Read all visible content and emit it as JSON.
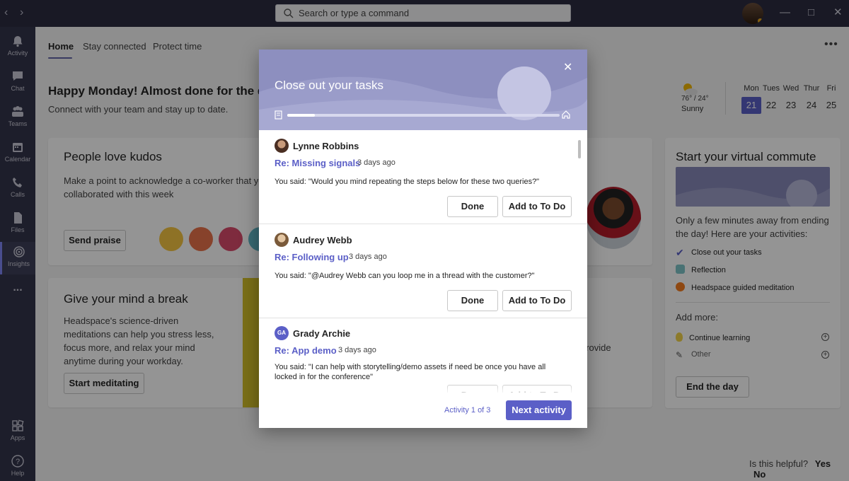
{
  "topbar": {
    "search_placeholder": "Search or type a command"
  },
  "rail": {
    "items": [
      {
        "label": "Activity",
        "icon": "bell-icon"
      },
      {
        "label": "Chat",
        "icon": "chat-icon"
      },
      {
        "label": "Teams",
        "icon": "teams-icon"
      },
      {
        "label": "Calendar",
        "icon": "calendar-icon"
      },
      {
        "label": "Calls",
        "icon": "phone-icon"
      },
      {
        "label": "Files",
        "icon": "file-icon"
      },
      {
        "label": "Insights",
        "icon": "insights-icon"
      },
      {
        "label": "...",
        "icon": "more-icon"
      },
      {
        "label": "Apps",
        "icon": "apps-icon"
      },
      {
        "label": "Help",
        "icon": "help-icon"
      }
    ]
  },
  "tabs": [
    "Home",
    "Stay connected",
    "Protect time"
  ],
  "greeting": {
    "title": "Happy Monday! Almost done for the day",
    "subtitle": "Connect with your team and stay up to date."
  },
  "weather": {
    "temp": "76° / 24°",
    "condition": "Sunny"
  },
  "week": {
    "days": [
      "Mon",
      "Tues",
      "Wed",
      "Thur",
      "Fri"
    ],
    "dates": [
      "21",
      "22",
      "23",
      "24",
      "25"
    ],
    "selected_index": 0
  },
  "kudos_card": {
    "title": "People love kudos",
    "text": "Make a point to acknowledge a co-worker that you collaborated with this week",
    "button": "Send praise"
  },
  "break_card": {
    "title": "Give your mind a break",
    "text": "Headspace's science-driven meditations can help you stress less, focus more, and relax your mind anytime during your workday.",
    "button": "Start meditating",
    "partial_text": "provide"
  },
  "commute_card": {
    "title": "Start your virtual commute",
    "text": "Only a few minutes away from ending the day! Here are your activities:",
    "activities": [
      "Close out your tasks",
      "Reflection",
      "Headspace guided meditation"
    ],
    "add_more_label": "Add more:",
    "add_more": [
      "Continue learning",
      "Other"
    ],
    "button": "End the day"
  },
  "helpful": {
    "question": "Is this helpful?",
    "yes": "Yes",
    "no": "No"
  },
  "modal": {
    "title": "Close out your tasks",
    "progress": 0.1,
    "tasks": [
      {
        "name": "Lynne Robbins",
        "subject": "Re: Missing signals",
        "time": "3 days ago",
        "quote": "You said: \"Would you mind repeating the steps below for these two queries?\"",
        "initials": ""
      },
      {
        "name": "Audrey Webb",
        "subject": "Re: Following up",
        "time": "3 days ago",
        "quote": "You said: \"@Audrey Webb can you loop me in a thread with the customer?\"",
        "initials": ""
      },
      {
        "name": "Grady Archie",
        "subject": "Re: App demo",
        "time": "3 days ago",
        "quote": "You said: \"I can help with storytelling/demo assets if need be once you have all locked in for the conference\"",
        "initials": "GA"
      }
    ],
    "done_label": "Done",
    "todo_label": "Add to To Do",
    "activity_count": "Activity 1 of 3",
    "next_label": "Next activity"
  },
  "colors": {
    "accent": "#5b5fc7",
    "header_bg": "#2b2b40",
    "rail_bg": "#33344a",
    "modal_header": "#8d8fbf"
  }
}
